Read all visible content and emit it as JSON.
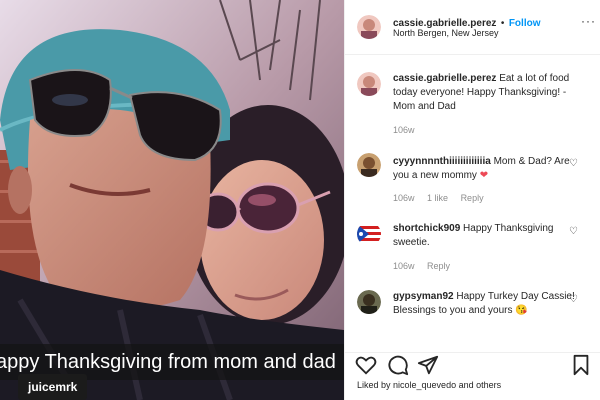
{
  "post": {
    "username": "cassie.gabrielle.perez",
    "follow_label": "Follow",
    "dot": "•",
    "location": "North Bergen, New Jersey",
    "more_label": "···",
    "caption_overlay": "appy Thanksgiving from mom and dad",
    "tag_label": "juicemrk"
  },
  "caption": {
    "username": "cassie.gabrielle.perez",
    "text": "Eat a lot of food today everyone! Happy Thanksgiving! - Mom and Dad",
    "time": "106w"
  },
  "comments": [
    {
      "username": "cyyynnnnthiiiiiiiiiiiiia",
      "text": "Mom & Dad? Are you a new mommy",
      "emoji": "❤",
      "time": "106w",
      "likes": "1 like",
      "reply": "Reply"
    },
    {
      "username": "shortchick909",
      "text": "Happy Thanksgiving sweetie.",
      "time": "106w",
      "reply": "Reply"
    },
    {
      "username": "gypsyman92",
      "text": "Happy Turkey Day Cassie! Blessings to you and yours",
      "emoji": "😘"
    }
  ],
  "likes_text": "Liked by nicole_quevedo and others",
  "icons": {
    "like": "heart-outline-icon",
    "comment": "comment-bubble-icon",
    "share": "paper-plane-icon",
    "save": "bookmark-icon"
  },
  "colors": {
    "accent": "#0095f6",
    "text": "#262626",
    "muted": "#8e8e8e",
    "heart": "#ed4956"
  }
}
